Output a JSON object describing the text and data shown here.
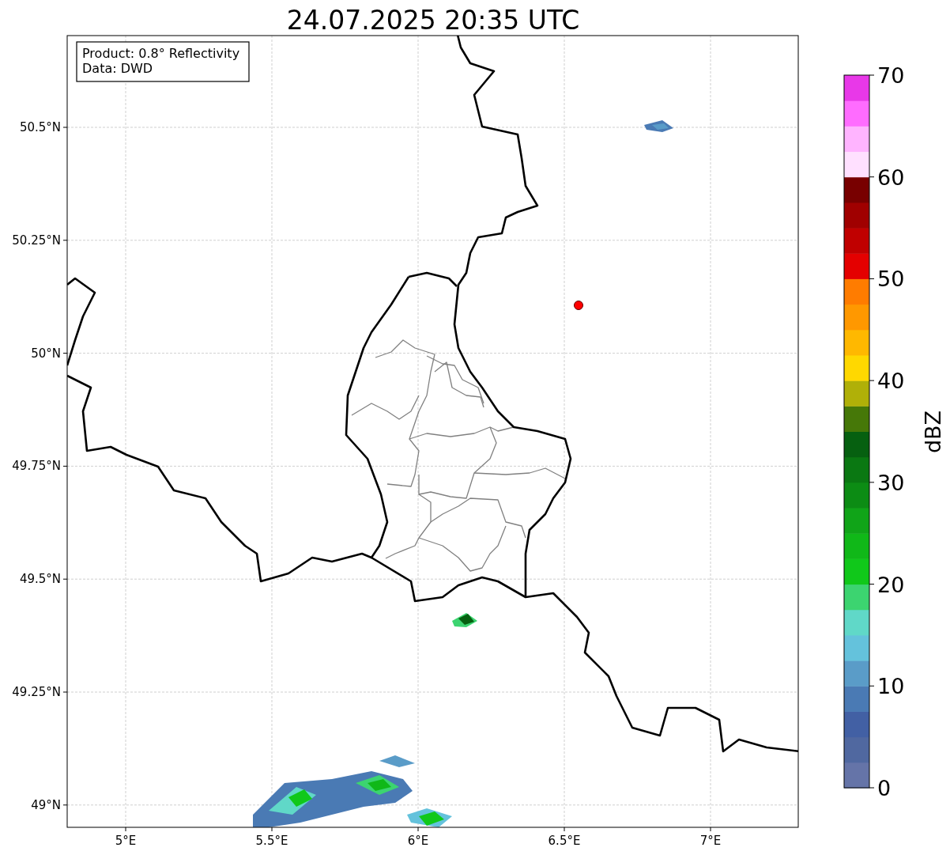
{
  "title": "24.07.2025 20:35 UTC",
  "info_box": [
    "Product: 0.8° Reflectivity",
    "Data: DWD"
  ],
  "map": {
    "x_ticks": [
      "5°E",
      "5.5°E",
      "6°E",
      "6.5°E",
      "7°E"
    ],
    "y_ticks": [
      "50.5°N",
      "50.25°N",
      "50°N",
      "49.75°N",
      "49.5°N",
      "49.25°N",
      "49°N"
    ]
  },
  "colorbar": {
    "label": "dBZ",
    "ticks": [
      "70",
      "60",
      "50",
      "40",
      "30",
      "20",
      "10",
      "0"
    ],
    "bins": [
      {
        "color": "#6574a8"
      },
      {
        "color": "#5068a0"
      },
      {
        "color": "#4260a4"
      },
      {
        "color": "#4a7ab4"
      },
      {
        "color": "#5a9cc8"
      },
      {
        "color": "#64c2dc"
      },
      {
        "color": "#60d8c8"
      },
      {
        "color": "#3cd470"
      },
      {
        "color": "#10c81a"
      },
      {
        "color": "#10b818"
      },
      {
        "color": "#10a418"
      },
      {
        "color": "#0c8c14"
      },
      {
        "color": "#0a7812"
      },
      {
        "color": "#066010"
      },
      {
        "color": "#467808"
      },
      {
        "color": "#b0b008"
      },
      {
        "color": "#ffd800"
      },
      {
        "color": "#ffb800"
      },
      {
        "color": "#ff9800"
      },
      {
        "color": "#ff7c00"
      },
      {
        "color": "#e40000"
      },
      {
        "color": "#c00000"
      },
      {
        "color": "#a00000"
      },
      {
        "color": "#780000"
      },
      {
        "color": "#ffe0ff"
      },
      {
        "color": "#ffb4ff"
      },
      {
        "color": "#ff6cff"
      },
      {
        "color": "#e838e8"
      }
    ]
  }
}
